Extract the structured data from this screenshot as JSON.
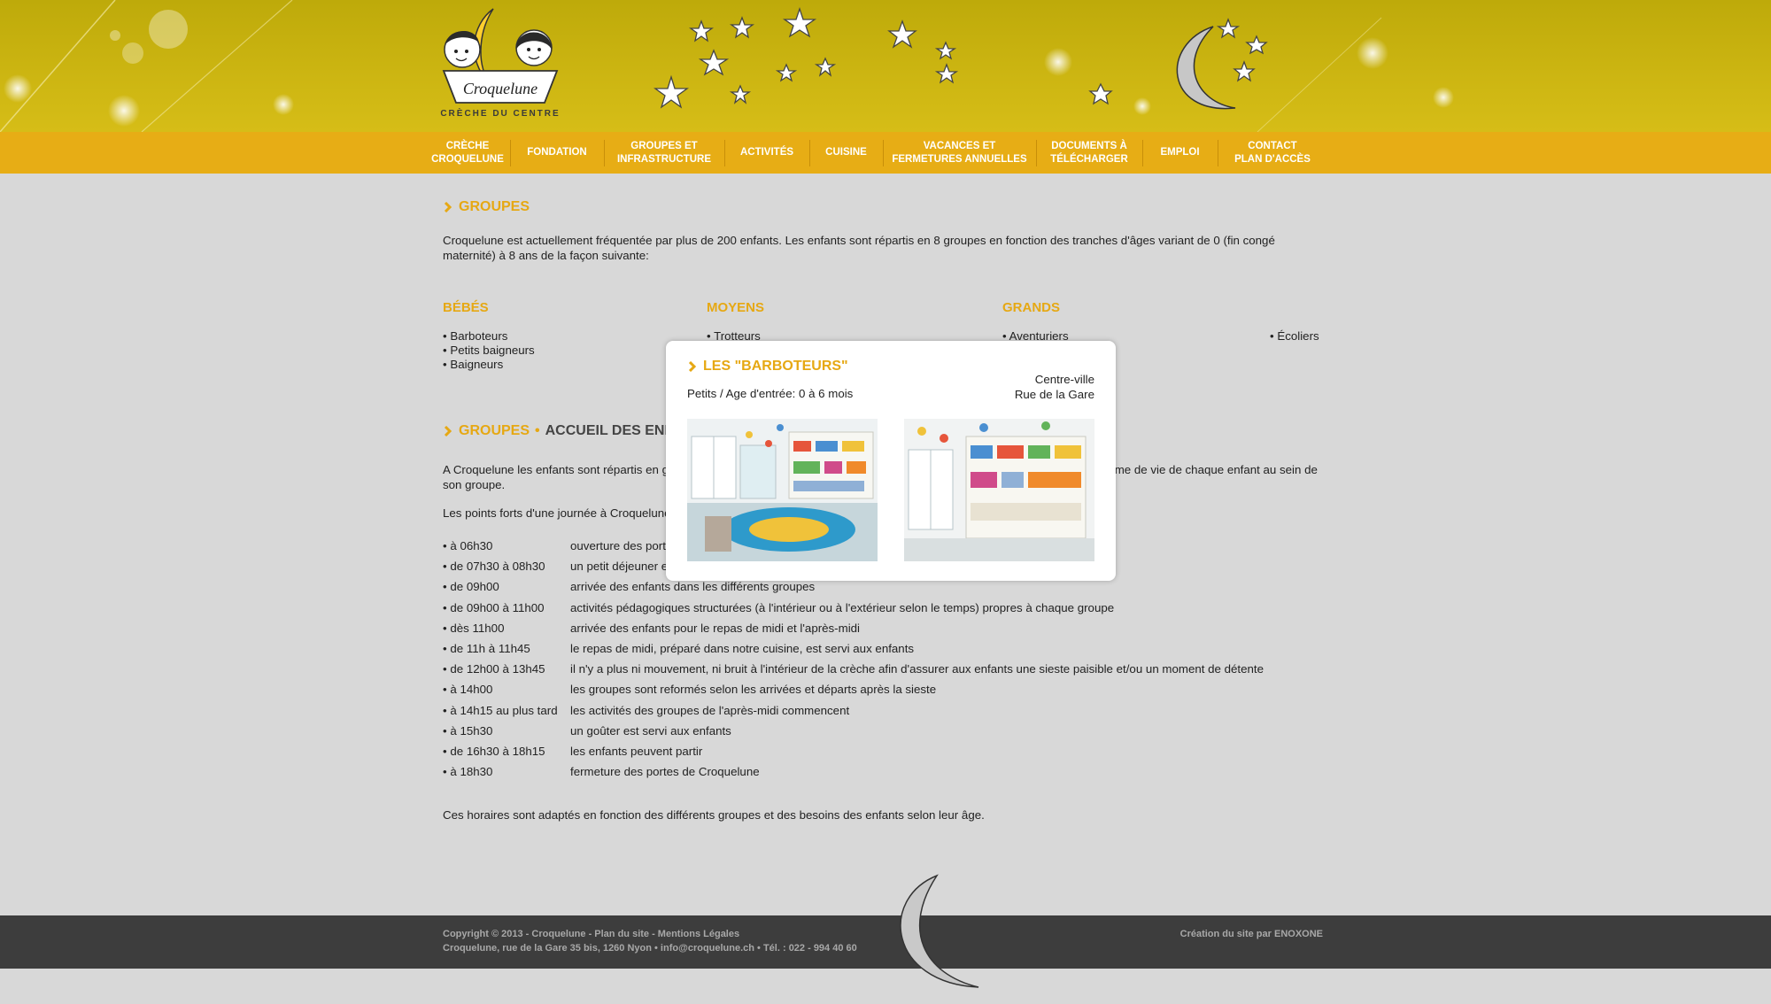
{
  "logo": {
    "name": "Croquelune",
    "tagline": "CRÈCHE DU CENTRE"
  },
  "nav": [
    {
      "label": "CRÈCHE\nCROQUELUNE",
      "w": 96
    },
    {
      "label": "FONDATION",
      "w": 106
    },
    {
      "label": "GROUPES ET\nINFRASTRUCTURE",
      "w": 136
    },
    {
      "label": "ACTIVITÉS",
      "w": 96
    },
    {
      "label": "CUISINE",
      "w": 83
    },
    {
      "label": "VACANCES ET\nFERMETURES ANNUELLES",
      "w": 173
    },
    {
      "label": "DOCUMENTS À\nTÉLÉCHARGER",
      "w": 120
    },
    {
      "label": "EMPLOI",
      "w": 85
    },
    {
      "label": "CONTACT\nPLAN  D'ACCÈS",
      "w": 124
    }
  ],
  "groupes": {
    "title": "GROUPES",
    "intro": "Croquelune est actuellement fréquentée par plus de 200 enfants. Les enfants sont répartis en 8 groupes en fonction des tranches d'âges variant de 0 (fin congé maternité) à 8 ans de la façon suivante:",
    "bebes": {
      "title": "BÉBÉS",
      "items": [
        "• Barboteurs",
        "• Petits baigneurs",
        "• Baigneurs"
      ]
    },
    "moyens": {
      "title": "MOYENS",
      "items": [
        "• Trotteurs"
      ]
    },
    "grands": {
      "title": "GRANDS",
      "items": [
        "• Aventuriers"
      ]
    },
    "ecoliers": "• Écoliers"
  },
  "accueil": {
    "crumb1": "GROUPES",
    "crumb_sep": "•",
    "crumb2": "ACCUEIL DES ENFANTS",
    "p1": "A Croquelune les enfants sont répartis en groupes adaptés à leur âge, ce qui permet de respecter au mieux l'organisation du rythme de vie de chaque enfant au sein de son groupe.",
    "p2": "Les points forts d'une journée à Croquelune:",
    "schedule": [
      {
        "t": "• à 06h30",
        "d": "ouverture des portes de Croquelune"
      },
      {
        "t": "• de 07h30 à 08h30",
        "d": "un petit déjeuner est servi aux enfants"
      },
      {
        "t": "• de 09h00",
        "d": "arrivée des enfants dans les différents groupes"
      },
      {
        "t": "• de 09h00 à 11h00",
        "d": "activités pédagogiques structurées (à l'intérieur ou à l'extérieur selon le temps) propres à chaque groupe"
      },
      {
        "t": "• dès 11h00",
        "d": "arrivée des enfants pour le repas de midi et l'après-midi"
      },
      {
        "t": "• de 11h à 11h45",
        "d": "le repas de midi, préparé dans notre cuisine, est servi aux enfants"
      },
      {
        "t": "• de 12h00 à 13h45",
        "d": "il n'y a plus ni mouvement, ni bruit à l'intérieur de la crèche afin d'assurer aux enfants une sieste paisible et/ou un moment de détente"
      },
      {
        "t": "• à 14h00",
        "d": "les groupes sont reformés selon les arrivées et départs après la sieste"
      },
      {
        "t": "• à 14h15 au plus tard",
        "d": "les activités des groupes de l'après-midi commencent"
      },
      {
        "t": "• à 15h30",
        "d": "un goûter est servi aux enfants"
      },
      {
        "t": "• de 16h30 à 18h15",
        "d": "les enfants peuvent partir"
      },
      {
        "t": "• à 18h30",
        "d": "fermeture des portes de Croquelune"
      }
    ],
    "p3": "Ces horaires sont adaptés en fonction des différents groupes et des besoins des enfants selon leur âge."
  },
  "popup": {
    "title": "LES \"BARBOTEURS\"",
    "subtitle": "Petits / Age d'entrée: 0 à 6 mois",
    "loc1": "Centre-ville",
    "loc2": "Rue de la Gare"
  },
  "footer": {
    "line1": "Copyright © 2013 - Croquelune - Plan du site - Mentions Légales",
    "line2": "Croquelune, rue de la Gare 35 bis, 1260 Nyon • info@croquelune.ch • Tél. : 022 - 994 40 60",
    "credit": "Création du site par ENOXONE"
  },
  "colors": {
    "accent": "#e6a813",
    "nav_bg": "#e7ad15",
    "header_bg": "#c9b30f",
    "footer_bg": "#3d3d3d"
  }
}
